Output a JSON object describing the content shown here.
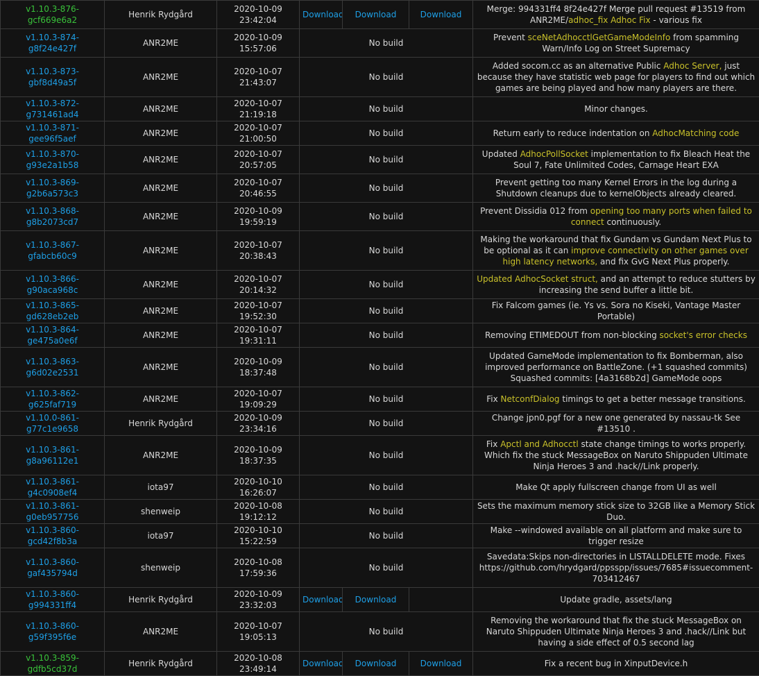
{
  "colors": {
    "version_link": "#1e9fe6",
    "version_built": "#39c23a",
    "download_link": "#1e9fe6",
    "highlight": "#c9c12a"
  },
  "rows": [
    {
      "version": "v1.10.3-876-gcf669e6a2",
      "built": true,
      "author": "Henrik Rydgård",
      "date": "2020-10-09 23:42:04",
      "downloads": [
        "Download",
        "Download",
        "Download"
      ],
      "nobuild": "",
      "height": 41,
      "message": [
        {
          "t": "Merge: 994331ff4 8f24e427f Merge pull request #13519 from ANR2ME/"
        },
        {
          "t": "adhoc_fix Adhoc Fix",
          "h": true
        },
        {
          "t": " - various fix"
        }
      ]
    },
    {
      "version": "v1.10.3-874-g8f24e427f",
      "built": false,
      "author": "ANR2ME",
      "date": "2020-10-09 15:57:06",
      "downloads": [],
      "nobuild": "No build",
      "height": 41,
      "message": [
        {
          "t": "Prevent "
        },
        {
          "t": "sceNetAdhocctlGetGameModeInfo",
          "h": true
        },
        {
          "t": " from spamming Warn/Info Log on Street Supremacy"
        }
      ]
    },
    {
      "version": "v1.10.3-873-gbf8d49a5f",
      "built": false,
      "author": "ANR2ME",
      "date": "2020-10-07 21:43:07",
      "downloads": [],
      "nobuild": "No build",
      "height": 57,
      "message": [
        {
          "t": "Added socom.cc as an alternative Public "
        },
        {
          "t": "Adhoc Server,",
          "h": true
        },
        {
          "t": " just because they have statistic web page for players to find out which games are being played and how many players are there."
        }
      ]
    },
    {
      "version": "v1.10.3-872-g731461ad4",
      "built": false,
      "author": "ANR2ME",
      "date": "2020-10-07 21:19:18",
      "downloads": [],
      "nobuild": "No build",
      "height": 25,
      "message": [
        {
          "t": "Minor changes."
        }
      ]
    },
    {
      "version": "v1.10.3-871-gee96f5aef",
      "built": false,
      "author": "ANR2ME",
      "date": "2020-10-07 21:00:50",
      "downloads": [],
      "nobuild": "No build",
      "height": 25,
      "message": [
        {
          "t": "Return early to reduce indentation on "
        },
        {
          "t": "AdhocMatching code",
          "h": true
        }
      ]
    },
    {
      "version": "v1.10.3-870-g93e2a1b58",
      "built": false,
      "author": "ANR2ME",
      "date": "2020-10-07 20:57:05",
      "downloads": [],
      "nobuild": "No build",
      "height": 41,
      "message": [
        {
          "t": "Updated "
        },
        {
          "t": "AdhocPollSocket",
          "h": true
        },
        {
          "t": " implementation to fix Bleach Heat the Soul 7, Fate Unlimited Codes, Carnage Heart EXA"
        }
      ]
    },
    {
      "version": "v1.10.3-869-g2b6a573c3",
      "built": false,
      "author": "ANR2ME",
      "date": "2020-10-07 20:46:55",
      "downloads": [],
      "nobuild": "No build",
      "height": 41,
      "message": [
        {
          "t": "Prevent getting too many Kernel Errors in the log during a Shutdown cleanups due to kernelObjects already cleared."
        }
      ]
    },
    {
      "version": "v1.10.3-868-g8b2073cd7",
      "built": false,
      "author": "ANR2ME",
      "date": "2020-10-09 19:59:19",
      "downloads": [],
      "nobuild": "No build",
      "height": 41,
      "message": [
        {
          "t": "Prevent Dissidia 012 from "
        },
        {
          "t": "opening too many ports when failed to connect",
          "h": true
        },
        {
          "t": " continuously."
        }
      ]
    },
    {
      "version": "v1.10.3-867-gfabcb60c9",
      "built": false,
      "author": "ANR2ME",
      "date": "2020-10-07 20:38:43",
      "downloads": [],
      "nobuild": "No build",
      "height": 57,
      "message": [
        {
          "t": "Making the workaround that fix Gundam vs Gundam Next Plus to be optional as it can "
        },
        {
          "t": "improve connectivity on other games over high latency networks,",
          "h": true
        },
        {
          "t": " and fix GvG Next Plus properly."
        }
      ]
    },
    {
      "version": "v1.10.3-866-g90aca968c",
      "built": false,
      "author": "ANR2ME",
      "date": "2020-10-07 20:14:32",
      "downloads": [],
      "nobuild": "No build",
      "height": 41,
      "message": [
        {
          "t": "Updated AdhocSocket struct,",
          "h": true
        },
        {
          "t": " and an attempt to reduce stutters by increasing the send buffer a little bit."
        }
      ]
    },
    {
      "version": "v1.10.3-865-gd628eb2eb",
      "built": false,
      "author": "ANR2ME",
      "date": "2020-10-07 19:52:30",
      "downloads": [],
      "nobuild": "No build",
      "height": 25,
      "message": [
        {
          "t": "Fix Falcom games (ie. Ys vs. Sora no Kiseki, Vantage Master Portable)"
        }
      ]
    },
    {
      "version": "v1.10.3-864-ge475a0e6f",
      "built": false,
      "author": "ANR2ME",
      "date": "2020-10-07 19:31:11",
      "downloads": [],
      "nobuild": "No build",
      "height": 25,
      "message": [
        {
          "t": "Removing ETIMEDOUT from non-blocking "
        },
        {
          "t": "socket's error checks",
          "h": true
        }
      ]
    },
    {
      "version": "v1.10.3-863-g6d02e2531",
      "built": false,
      "author": "ANR2ME",
      "date": "2020-10-09 18:37:48",
      "downloads": [],
      "nobuild": "No build",
      "height": 57,
      "message": [
        {
          "t": "Updated GameMode implementation to fix Bomberman, also improved performance on BattleZone. (+1 squashed commits) Squashed commits: [4a3168b2d] GameMode oops"
        }
      ]
    },
    {
      "version": "v1.10.3-862-g625faf719",
      "built": false,
      "author": "ANR2ME",
      "date": "2020-10-07 19:09:29",
      "downloads": [],
      "nobuild": "No build",
      "height": 25,
      "message": [
        {
          "t": "Fix "
        },
        {
          "t": "NetconfDialog",
          "h": true
        },
        {
          "t": " timings to get a better message transitions."
        }
      ]
    },
    {
      "version": "v1.10.0-861-g77c1e9658",
      "built": false,
      "author": "Henrik Rydgård",
      "date": "2020-10-09 23:34:16",
      "downloads": [],
      "nobuild": "No build",
      "height": 25,
      "message": [
        {
          "t": "Change jpn0.pgf for a new one generated by nassau-tk See #13510 ."
        }
      ]
    },
    {
      "version": "v1.10.3-861-g8a96112e1",
      "built": false,
      "author": "ANR2ME",
      "date": "2020-10-09 18:37:35",
      "downloads": [],
      "nobuild": "No build",
      "height": 57,
      "message": [
        {
          "t": "Fix "
        },
        {
          "t": "Apctl and Adhocctl",
          "h": true
        },
        {
          "t": " state change timings to works properly. Which fix the stuck MessageBox on Naruto Shippuden Ultimate Ninja Heroes 3 and .hack//Link properly."
        }
      ]
    },
    {
      "version": "v1.10.3-861-g4c0908ef4",
      "built": false,
      "author": "iota97",
      "date": "2020-10-10 16:26:07",
      "downloads": [],
      "nobuild": "No build",
      "height": 25,
      "message": [
        {
          "t": "Make Qt apply fullscreen change from UI as well"
        }
      ]
    },
    {
      "version": "v1.10.3-861-g0eb957756",
      "built": false,
      "author": "shenweip",
      "date": "2020-10-08 19:12:12",
      "downloads": [],
      "nobuild": "No build",
      "height": 25,
      "message": [
        {
          "t": "Sets the maximum memory stick size to 32GB like a Memory Stick Duo."
        }
      ]
    },
    {
      "version": "v1.10.3-860-gcd42f8b3a",
      "built": false,
      "author": "iota97",
      "date": "2020-10-10 15:22:59",
      "downloads": [],
      "nobuild": "No build",
      "height": 25,
      "message": [
        {
          "t": "Make --windowed available on all platform and make sure to trigger resize"
        }
      ]
    },
    {
      "version": "v1.10.3-860-gaf435794d",
      "built": false,
      "author": "shenweip",
      "date": "2020-10-08 17:59:36",
      "downloads": [],
      "nobuild": "No build",
      "height": 57,
      "message": [
        {
          "t": "Savedata:Skips non-directories in LISTALLDELETE mode. Fixes https://github.com/hrydgard/ppsspp/issues/7685#issuecomment-703412467"
        }
      ]
    },
    {
      "version": "v1.10.3-860-g994331ff4",
      "built": false,
      "author": "Henrik Rydgård",
      "date": "2020-10-09 23:32:03",
      "downloads": [
        "Download",
        "Download"
      ],
      "nobuild": "",
      "height": 25,
      "message": [
        {
          "t": "Update gradle, assets/lang"
        }
      ]
    },
    {
      "version": "v1.10.3-860-g59f395f6e",
      "built": false,
      "author": "ANR2ME",
      "date": "2020-10-07 19:05:13",
      "downloads": [],
      "nobuild": "No build",
      "height": 57,
      "message": [
        {
          "t": "Removing the workaround that fix the stuck MessageBox on Naruto Shippuden Ultimate Ninja Heroes 3 and .hack//Link but having a side effect of 0.5 second lag"
        }
      ]
    },
    {
      "version": "v1.10.3-859-gdfb5cd37d",
      "built": true,
      "author": "Henrik Rydgård",
      "date": "2020-10-08 23:49:14",
      "downloads": [
        "Download",
        "Download",
        "Download"
      ],
      "nobuild": "",
      "height": 25,
      "message": [
        {
          "t": "Fix a recent bug in XinputDevice.h"
        }
      ]
    }
  ]
}
